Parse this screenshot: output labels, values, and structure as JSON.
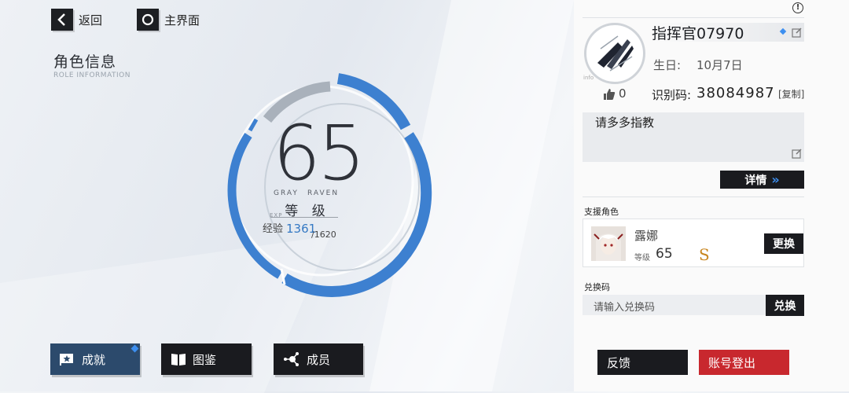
{
  "nav": {
    "back_label": "返回",
    "home_label": "主界面"
  },
  "page": {
    "title": "角色信息",
    "subtitle": "ROLE INFORMATION"
  },
  "level": {
    "value": "65",
    "gray": "GRAY",
    "raven": "RAVEN",
    "label": "等 级",
    "exp_small": "EXP",
    "exp_label": "经验",
    "exp_current": "1361",
    "exp_max": "/1620",
    "exp_fraction": 0.84
  },
  "bottom_buttons": {
    "achievements": "成就",
    "codex": "图鉴",
    "members": "成员"
  },
  "profile": {
    "info_icon": "!",
    "avatar_caption": "info",
    "name": "指挥官07970",
    "birthday_label": "生日:",
    "birthday_value": "10月7日",
    "likes": "0",
    "uid_label": "识别码:",
    "uid_value": "38084987",
    "copy_label": "[复制]",
    "signature": "请多多指教",
    "details_label": "详情",
    "details_arrows": "»"
  },
  "support": {
    "section_label": "支援角色",
    "char_name": "露娜",
    "level_label": "等级",
    "level_value": "65",
    "rank": "S",
    "change_label": "更换"
  },
  "redeem": {
    "section_label": "兑换码",
    "placeholder": "请输入兑换码",
    "button_label": "兑换"
  },
  "footer": {
    "feedback_label": "反馈",
    "logout_label": "账号登出"
  },
  "colors": {
    "accent_blue": "#3d80d0",
    "logout_red": "#c8282e",
    "dark": "#1a1b1f"
  }
}
